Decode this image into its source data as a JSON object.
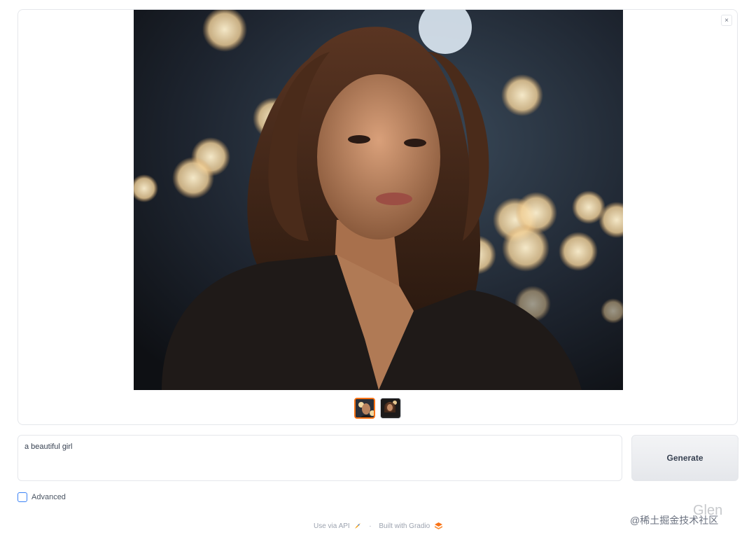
{
  "gallery": {
    "close_label": "×",
    "image_icon": "portrait-photo",
    "thumbnails": [
      "thumbnail-1",
      "thumbnail-2"
    ],
    "selected_index": 0
  },
  "prompt": {
    "value": "a beautiful girl"
  },
  "generate_button": {
    "label": "Generate"
  },
  "advanced": {
    "label": "Advanced",
    "checked": false
  },
  "footer": {
    "api_link": "Use via API",
    "separator": "·",
    "built_with": "Built with Gradio"
  },
  "watermark": {
    "name": "Glen",
    "text": "@稀土掘金技术社区"
  },
  "colors": {
    "accent": "#f97316",
    "checkbox_border": "#3b82f6",
    "border": "#e5e7eb"
  }
}
